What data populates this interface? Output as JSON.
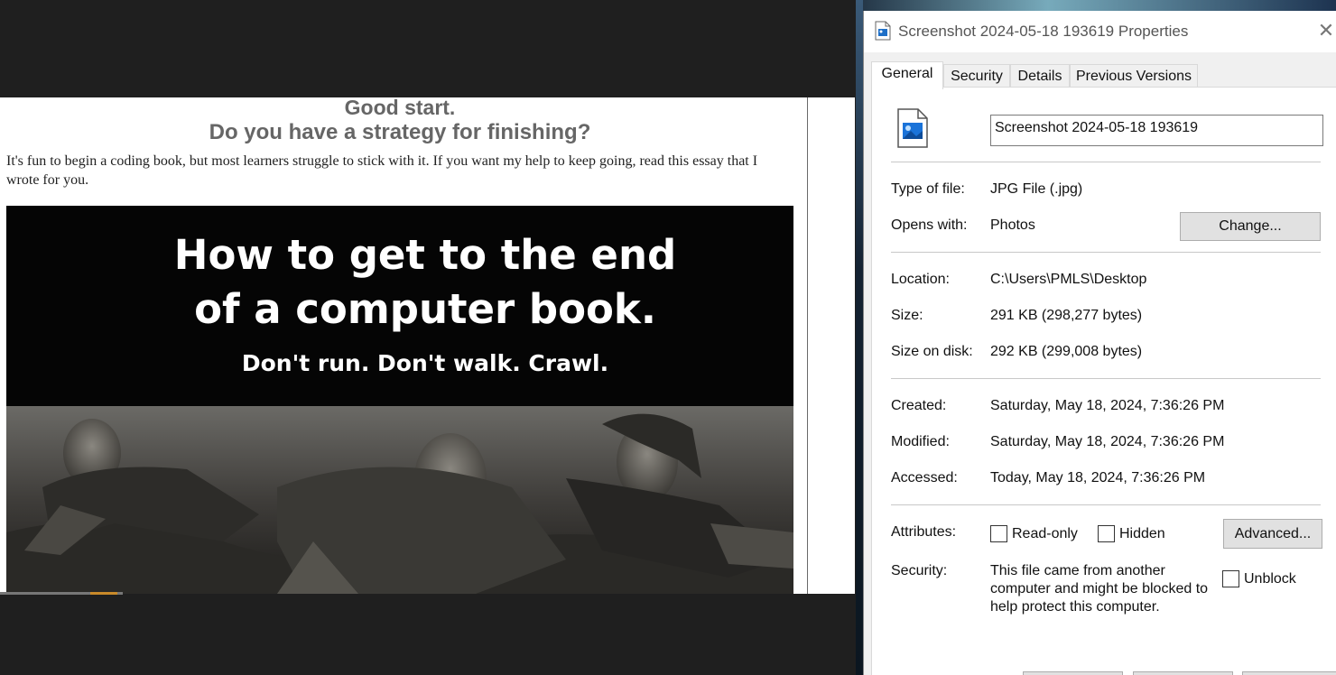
{
  "viewer": {
    "heading_line1": "Good start.",
    "heading_line2": "Do you have a strategy for finishing?",
    "intro": "It's fun to begin a coding book, but most learners struggle to stick with it. If you want my help to keep going, read this essay that I wrote for you.",
    "banner": {
      "title_line1": "How to get to the end",
      "title_line2": "of a computer book.",
      "subtitle": "Don't run. Don't walk. Crawl."
    }
  },
  "dialog": {
    "title": "Screenshot 2024-05-18 193619 Properties",
    "close_icon": "close-icon",
    "tabs": [
      {
        "label": "General",
        "active": true
      },
      {
        "label": "Security",
        "active": false
      },
      {
        "label": "Details",
        "active": false
      },
      {
        "label": "Previous Versions",
        "active": false
      }
    ],
    "file_name": "Screenshot 2024-05-18 193619",
    "type_label": "Type of file:",
    "type_value": "JPG File (.jpg)",
    "opens_label": "Opens with:",
    "opens_value": "Photos",
    "change_button": "Change...",
    "location_label": "Location:",
    "location_value": "C:\\Users\\PMLS\\Desktop",
    "size_label": "Size:",
    "size_value": "291 KB (298,277 bytes)",
    "size_disk_label": "Size on disk:",
    "size_disk_value": "292 KB (299,008 bytes)",
    "created_label": "Created:",
    "created_value": "Saturday, May 18, 2024, 7:36:26 PM",
    "modified_label": "Modified:",
    "modified_value": "Saturday, May 18, 2024, 7:36:26 PM",
    "accessed_label": "Accessed:",
    "accessed_value": "Today, May 18, 2024, 7:36:26 PM",
    "attributes_label": "Attributes:",
    "readonly_label": "Read-only",
    "hidden_label": "Hidden",
    "advanced_button": "Advanced...",
    "security_label": "Security:",
    "security_text": "This file came from another computer and might be blocked to help protect this computer.",
    "unblock_label": "Unblock"
  },
  "colors": {
    "viewer_bg": "#1f1f1f",
    "dialog_bg": "#f0f0f0",
    "heading_gray": "#666666",
    "button_gray": "#e1e1e1"
  }
}
